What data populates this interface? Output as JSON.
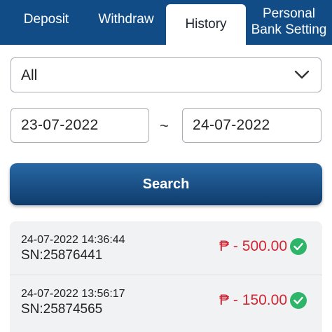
{
  "tabs": {
    "deposit": "Deposit",
    "withdraw": "Withdraw",
    "history": "History",
    "personal_line1": "Personal",
    "personal_line2": "Bank Setting"
  },
  "filter": {
    "type_value": "All",
    "date_from": "23-07-2022",
    "separator": "~",
    "date_to": "24-07-2022"
  },
  "search_label": "Search",
  "transactions": [
    {
      "time": "24-07-2022 14:36:44",
      "sn": "SN:25876441",
      "amount": "₱ - 500.00",
      "status_icon": "check-circle-icon"
    },
    {
      "time": "24-07-2022 13:56:17",
      "sn": "SN:25874565",
      "amount": "₱ - 150.00",
      "status_icon": "check-circle-icon"
    }
  ],
  "colors": {
    "header_bg": "#124c86",
    "amount": "#d22634",
    "success": "#2fb56a"
  }
}
